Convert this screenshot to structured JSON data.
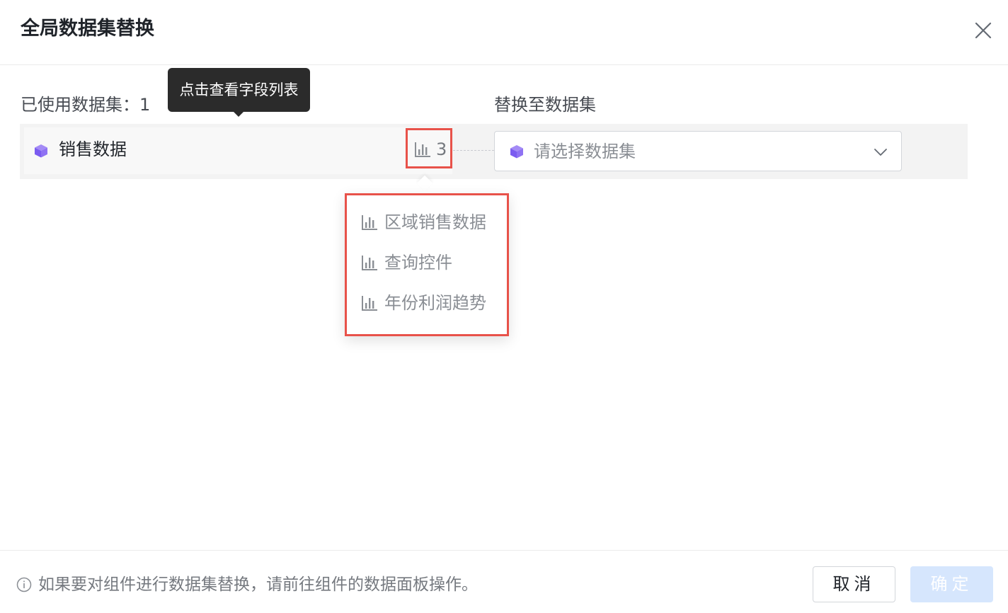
{
  "dialog": {
    "title": "全局数据集替换",
    "close_icon": "close-icon"
  },
  "left": {
    "label": "已使用数据集：1",
    "dataset_name": "销售数据",
    "dataset_icon": "cube-icon",
    "chart_count": "3",
    "chart_count_icon": "bar-chart-icon"
  },
  "tooltip": {
    "text": "点击查看字段列表"
  },
  "right": {
    "label": "替换至数据集",
    "select_placeholder": "请选择数据集",
    "select_icon": "cube-icon",
    "chevron_icon": "chevron-down-icon"
  },
  "popover": {
    "items": [
      {
        "label": "区域销售数据",
        "icon": "bar-chart-icon"
      },
      {
        "label": "查询控件",
        "icon": "bar-chart-icon"
      },
      {
        "label": "年份利润趋势",
        "icon": "bar-chart-icon"
      }
    ]
  },
  "footer": {
    "note_icon": "info-icon",
    "note": "如果要对组件进行数据集替换，请前往组件的数据面板操作。",
    "cancel_label": "取消",
    "ok_label": "确定"
  },
  "colors": {
    "highlight": "#e8524a",
    "cube": "#8b6cf2",
    "ok_disabled": "#d6e6fd"
  }
}
